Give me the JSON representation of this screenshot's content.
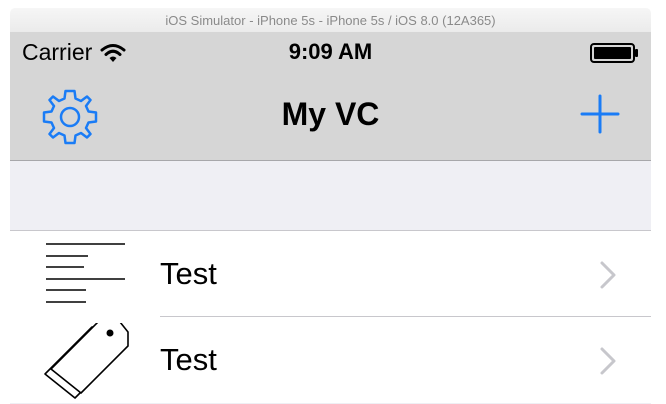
{
  "window": {
    "title": "iOS Simulator - iPhone 5s - iPhone 5s / iOS 8.0 (12A365)"
  },
  "status_bar": {
    "carrier": "Carrier",
    "time": "9:09 AM",
    "icons": [
      "wifi-icon",
      "battery-icon"
    ]
  },
  "nav_bar": {
    "title": "My VC",
    "left_icon": "gear-icon",
    "right_icon": "plus-icon",
    "accent_color": "#1a7cf6"
  },
  "table": {
    "rows": [
      {
        "label": "Test",
        "icon": "text-lines-icon"
      },
      {
        "label": "Test",
        "icon": "price-tag-icon"
      }
    ]
  },
  "colors": {
    "nav_background": "#d6d6d6",
    "table_background": "#efeff4",
    "separator": "#c8c7cc",
    "chevron": "#c7c7cc"
  }
}
